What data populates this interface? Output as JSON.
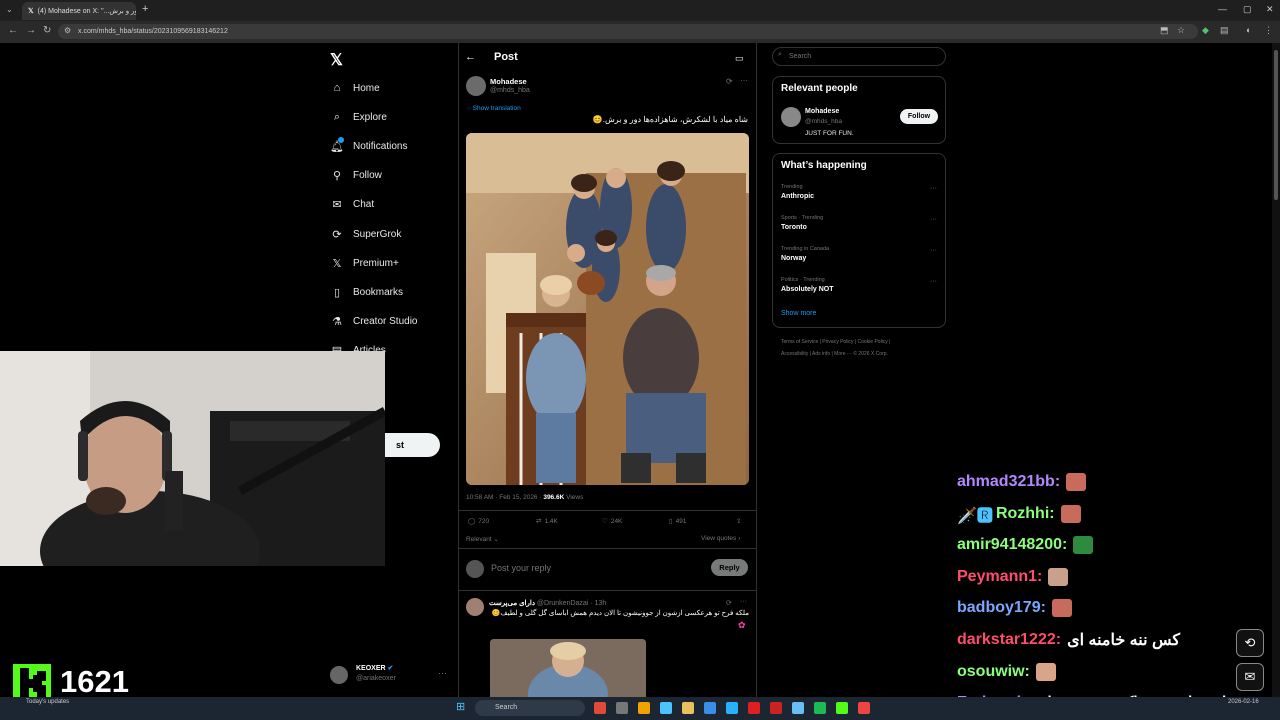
{
  "browser": {
    "tab_title": "(4) Mohadese on X: \"...دور و برش",
    "url": "x.com/mhds_hba/status/2023109569183146212"
  },
  "nav": {
    "items": [
      {
        "label": "Home",
        "icon": "home-icon"
      },
      {
        "label": "Explore",
        "icon": "search-icon"
      },
      {
        "label": "Notifications",
        "icon": "bell-icon"
      },
      {
        "label": "Follow",
        "icon": "person-plus-icon"
      },
      {
        "label": "Chat",
        "icon": "mail-icon"
      },
      {
        "label": "SuperGrok",
        "icon": "grok-icon"
      },
      {
        "label": "Premium+",
        "icon": "x-icon"
      },
      {
        "label": "Bookmarks",
        "icon": "bookmark-icon"
      },
      {
        "label": "Creator Studio",
        "icon": "flask-icon"
      },
      {
        "label": "Articles",
        "icon": "article-icon"
      }
    ],
    "post_button_partial": "st",
    "profile_name": "KEOXER",
    "profile_handle": "@ariakeoxer"
  },
  "post": {
    "header": "Post",
    "author_name": "Mohadese",
    "author_handle": "@mhds_hba",
    "show_translation": "Show translation",
    "text": "شاه میاد با لشکرش، شاهزاده‌ها دور و برش.😊",
    "timestamp": "10:58 AM · Feb 15, 2026 · ",
    "views_count": "396.6K",
    "views_label": " Views",
    "replies": "720",
    "reposts": "1.4K",
    "likes": "24K",
    "bookmarks": "491",
    "sort": "Relevant ⌄",
    "view_quotes": "View quotes ›",
    "reply_placeholder": "Post your reply",
    "reply_button": "Reply"
  },
  "comment": {
    "name": "دارای می‌پرست",
    "handle": "@DrunkenDazai · 13h",
    "text": "ملکه فرح تو هرعکسی ازشون از جوونیشون تا الان دیدم همش اباسای گل گلی و لطیف😊"
  },
  "sidebar": {
    "search_placeholder": "Search",
    "relevant_title": "Relevant people",
    "rp_name": "Mohadese",
    "rp_handle": "@mhds_hba",
    "rp_bio": "JUST FOR FUN.",
    "follow_label": "Follow",
    "happening_title": "What’s happening",
    "trends": [
      {
        "meta": "Trending",
        "name": "Anthropic"
      },
      {
        "meta": "Sports · Trending",
        "name": "Toronto"
      },
      {
        "meta": "Trending in Canada",
        "name": "Norway"
      },
      {
        "meta": "Politics · Trending",
        "name": "Absolutely NOT"
      }
    ],
    "show_more": "Show more",
    "footer_line1": "Terms of Service   |   Privacy Policy   |   Cookie Policy   |",
    "footer_line2": "Accessibility   |   Ads info   |   More ···   © 2026 X Corp."
  },
  "chat": [
    {
      "user": "ahmad321bb:",
      "color": "#b388ff",
      "message": "",
      "emote": "#c96b5a"
    },
    {
      "user": "Rozhhi:",
      "color": "#8aff7a",
      "message": "",
      "emote": "#c96b5a",
      "prefix": "🗡️🆁"
    },
    {
      "user": "amir94148200:",
      "color": "#8aff7a",
      "message": "",
      "emote": "#2e8b3e"
    },
    {
      "user": "Peymann1:",
      "color": "#ff4d6a",
      "message": "",
      "emote": "#c9a08a"
    },
    {
      "user": "badboy179:",
      "color": "#7aa7ff",
      "message": "",
      "emote": "#c96b5a"
    },
    {
      "user": "darkstar1222:",
      "color": "#ff4d6a",
      "message": "کس ننه خامنه ای",
      "emote": ""
    },
    {
      "user": "osouwiw:",
      "color": "#8aff7a",
      "message": "",
      "emote": "#d9a58a"
    },
    {
      "user": "Farbuod:",
      "color": "#b388ff",
      "message": "حاجی پشمام خیلی ترسناک میشه صدات",
      "emote": ""
    }
  ],
  "stream": {
    "viewer_count": "1621"
  },
  "taskbar": {
    "search_label": "Search",
    "weather": "Today's updates",
    "clock": "2026-02-16"
  }
}
